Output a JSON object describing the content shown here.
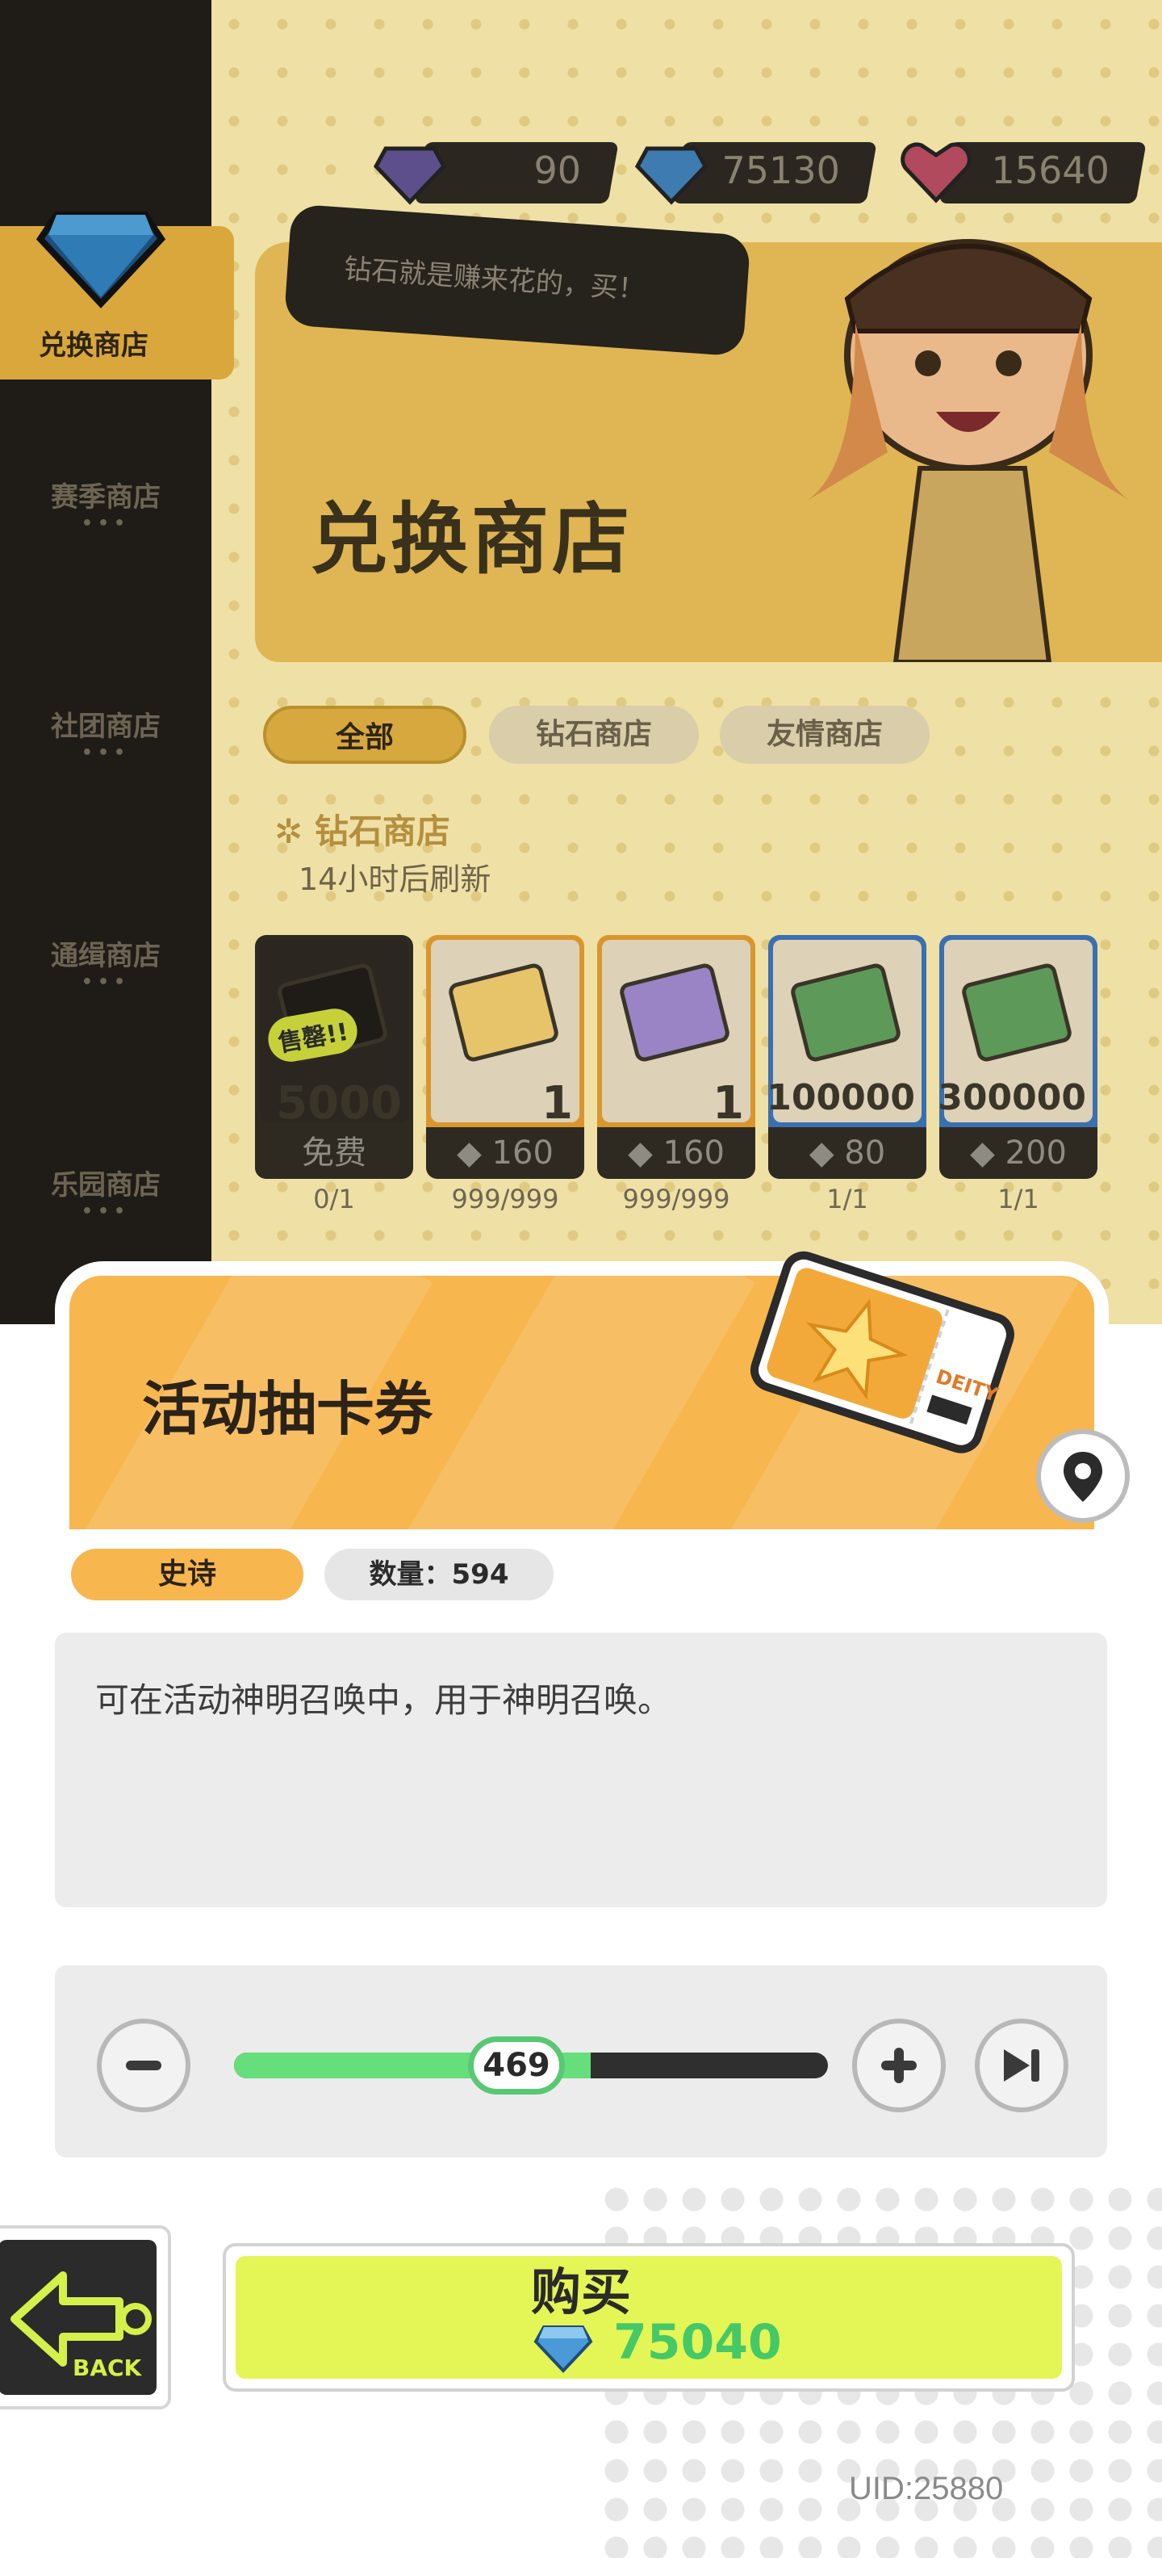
{
  "currencies": [
    {
      "icon": "purple-gem-icon",
      "value": "90"
    },
    {
      "icon": "blue-diamond-icon",
      "value": "75130"
    },
    {
      "icon": "red-heart-gem-icon",
      "value": "15640"
    }
  ],
  "sidebar": {
    "active": "兑换商店",
    "items": [
      {
        "label": "赛季商店"
      },
      {
        "label": "社团商店"
      },
      {
        "label": "通缉商店"
      },
      {
        "label": "乐园商店"
      }
    ]
  },
  "banner": {
    "speech": "钻石就是赚来花的，买！",
    "title": "兑换商店"
  },
  "tabs": [
    {
      "label": "全部",
      "active": true
    },
    {
      "label": "钻石商店",
      "active": false
    },
    {
      "label": "友情商店",
      "active": false
    }
  ],
  "section": {
    "title": "钻石商店",
    "refresh": "14小时后刷新"
  },
  "cards": [
    {
      "badge": "售罄!!",
      "qty": "5000",
      "price": "免费",
      "stock": "0/1",
      "border": "#2e2a22"
    },
    {
      "qty": "1",
      "price": "160",
      "stock": "999/999",
      "border": "#d9962e"
    },
    {
      "qty": "1",
      "price": "160",
      "stock": "999/999",
      "border": "#d9962e"
    },
    {
      "qty": "100000",
      "price": "80",
      "stock": "1/1",
      "border": "#3a6fb0"
    },
    {
      "qty": "300000",
      "price": "200",
      "stock": "1/1",
      "border": "#3a6fb0"
    }
  ],
  "item": {
    "name": "活动抽卡券",
    "rarity": "史诗",
    "count": "数量：594",
    "description": "可在活动神明召唤中，用于神明召唤。",
    "ticket_text": "DEITY"
  },
  "quantity": {
    "value": "469",
    "fraction": 0.6
  },
  "buy": {
    "label": "购买",
    "price": "75040"
  },
  "back_label": "BACK",
  "uid": "UID:25880",
  "colors": {
    "accent_orange": "#f7b64e",
    "buy_green": "#e3f655",
    "slider_green": "#66de7c"
  }
}
